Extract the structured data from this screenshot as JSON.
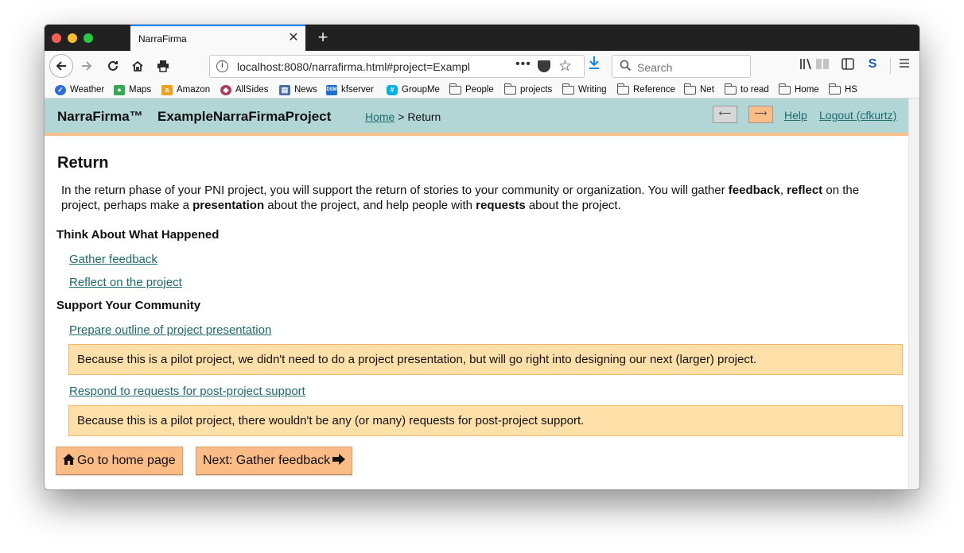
{
  "browser": {
    "tab_title": "NarraFirma",
    "tab_close": "✕",
    "new_tab": "+",
    "url": "localhost:8080/narrafirma.html#project=Exampl",
    "url_more": "•••",
    "search_placeholder": "Search",
    "bookmarks": [
      "Weather",
      "Maps",
      "Amazon",
      "AllSides",
      "News",
      "kfserver",
      "GroupMe",
      "People",
      "projects",
      "Writing",
      "Reference",
      "Net",
      "to read",
      "Home",
      "HS"
    ]
  },
  "header": {
    "brand": "NarraFirma™",
    "project": "ExampleNarraFirmaProject",
    "breadcrumb_home": "Home",
    "breadcrumb_rest": " > Return",
    "back_arrow": "⟵",
    "forward_arrow": "⟶",
    "help": "Help",
    "logout": "Logout (cfkurtz)"
  },
  "page": {
    "title": "Return",
    "intro": {
      "p1": "In the return phase of your PNI project, you will support the return of stories to your community or organization. You will gather ",
      "b1": "feedback",
      "p2": ", ",
      "b2": "reflect",
      "p3": " on the project, perhaps make a ",
      "b3": "presentation",
      "p4": " about the project, and help people with ",
      "b4": "requests",
      "p5": " about the project."
    },
    "section1": "Think About What Happened",
    "link_feedback": "Gather feedback",
    "link_reflect": "Reflect on the project",
    "section2": "Support Your Community",
    "link_presentation": "Prepare outline of project presentation",
    "note_presentation": "Because this is a pilot project, we didn't need to do a project presentation, but will go right into designing our next (larger) project.",
    "link_requests": "Respond to requests for post-project support",
    "note_requests": "Because this is a pilot project, there wouldn't be any (or many) requests for post-project support.",
    "btn_home": "Go to home page",
    "btn_next": "Next: Gather feedback"
  },
  "colors": {
    "header_bg": "#b2d5d6",
    "accent_orange": "#fbbc86",
    "note_bg": "#ffe0a8",
    "link": "#1e6b6e"
  }
}
